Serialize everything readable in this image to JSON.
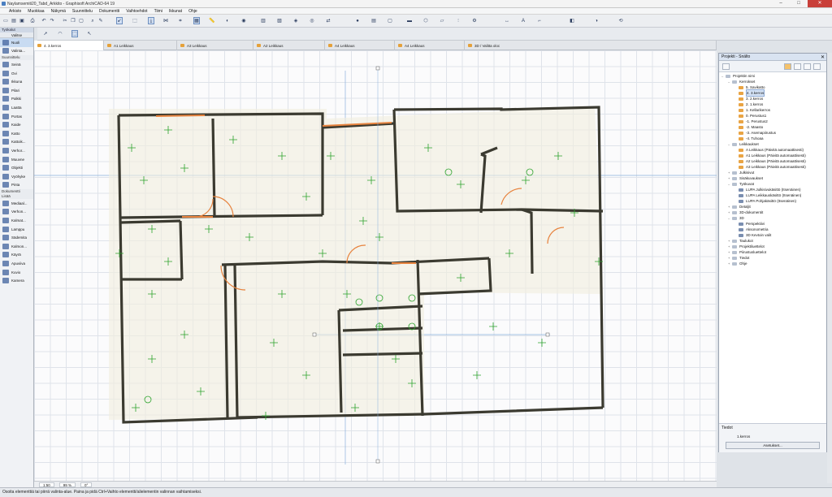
{
  "window": {
    "title": "Naylamsemiti20_Tabd_Arkkito - Graphisoft ArchiCAD-64 19",
    "min": "–",
    "max": "□",
    "close": "✕"
  },
  "menu": [
    "Arkisto",
    "Muokkaa",
    "Näkymä",
    "Suunnittelu",
    "Dokumentti",
    "Vaihtoehdot",
    "Tiimi",
    "Ikkunat",
    "Ohje"
  ],
  "tabs": [
    {
      "label": "4. 3.kerros"
    },
    {
      "label": "A1 Leikkaus"
    },
    {
      "label": "A3 Leikkaus"
    },
    {
      "label": "A2 Leikkaus"
    },
    {
      "label": "A4 Leikkaus"
    },
    {
      "label": "A4 Leikkaus"
    },
    {
      "label": "3D / Valitta oloc"
    }
  ],
  "toolbox": {
    "title": "Työkalut",
    "select": "Valitse",
    "items_top": [
      "Nuoli",
      "Valinta..."
    ],
    "group1": "Suunnittelu",
    "items1": [
      "Seinä",
      "Ovi",
      "Ikkuna",
      "Pilari",
      "Palkki",
      "Laatta",
      "Portas",
      "Kaide",
      "Katto",
      "Kattoik...",
      "Verhor...",
      "Muuvne",
      "Objekti",
      "Vyöhyke",
      "Pinta"
    ],
    "group2": "Dokumentti",
    "group3": "Lisää",
    "items2": [
      "Mediaal...",
      "Verhon...",
      "Kalmat...",
      "Lamppu",
      "Sädemita",
      "Kalmon...",
      "Käyrä",
      "Apuviiva",
      "Kuvio",
      "Kamera"
    ]
  },
  "navigator": {
    "title": "Projekti - Snälto",
    "close": "✕",
    "tree": [
      {
        "l": 0,
        "t": "Projektin nimi",
        "k": "grp",
        "e": "–"
      },
      {
        "l": 1,
        "t": "Kerrokset",
        "k": "grp",
        "e": "–"
      },
      {
        "l": 2,
        "t": "5. Savikatto",
        "k": "st"
      },
      {
        "l": 2,
        "t": "4. 3.kerros",
        "k": "st",
        "sel": true
      },
      {
        "l": 2,
        "t": "3. 2.kerros",
        "k": "st"
      },
      {
        "l": 2,
        "t": "2. 1.kerros",
        "k": "st"
      },
      {
        "l": 2,
        "t": "1. Kellarikerros",
        "k": "st"
      },
      {
        "l": 2,
        "t": "0. Perustus1",
        "k": "st"
      },
      {
        "l": 2,
        "t": "-1. Perustus2",
        "k": "st"
      },
      {
        "l": 2,
        "t": "-2. Maasto",
        "k": "st"
      },
      {
        "l": 2,
        "t": "-3. Asemapiirustus",
        "k": "st"
      },
      {
        "l": 2,
        "t": "-4. Tuhoaa",
        "k": "st"
      },
      {
        "l": 1,
        "t": "Leikkaukset",
        "k": "grp",
        "e": "–"
      },
      {
        "l": 2,
        "t": "A Leikkaus (Päivitä automaattisesti)",
        "k": "st"
      },
      {
        "l": 2,
        "t": "A1 Leikkaus (Päivitä automaattisesti)",
        "k": "st"
      },
      {
        "l": 2,
        "t": "A2 Leikkaus (Päivitä automaattisesti)",
        "k": "st"
      },
      {
        "l": 2,
        "t": "A3 Leikkaus (Päivitä automaattisesti)",
        "k": "st"
      },
      {
        "l": 1,
        "t": "Julkisivut",
        "k": "grp",
        "e": "+"
      },
      {
        "l": 1,
        "t": "Sisäkuvaukset",
        "k": "grp",
        "e": "+"
      },
      {
        "l": 1,
        "t": "Työkuvat",
        "k": "grp",
        "e": "–"
      },
      {
        "l": 2,
        "t": "LUPA Julkisivukäsittö (Itsenäinen)",
        "k": "lay"
      },
      {
        "l": 2,
        "t": "LUPA Leikkauskäsittö (Itsenäinen)",
        "k": "lay"
      },
      {
        "l": 2,
        "t": "LUPA Pohjakäsittö (Itsenäinen)",
        "k": "lay"
      },
      {
        "l": 1,
        "t": "Detaljit",
        "k": "grp",
        "e": "+"
      },
      {
        "l": 1,
        "t": "3D-dokumentit",
        "k": "grp",
        "e": "+"
      },
      {
        "l": 1,
        "t": "3D",
        "k": "grp",
        "e": "–"
      },
      {
        "l": 2,
        "t": "Perspektiivi",
        "k": "lay"
      },
      {
        "l": 2,
        "t": "Aksonometria",
        "k": "lay"
      },
      {
        "l": 2,
        "t": "3D Kevtoin valit",
        "k": "lay"
      },
      {
        "l": 1,
        "t": "Taulukot",
        "k": "grp",
        "e": "+"
      },
      {
        "l": 1,
        "t": "Projektiluettelot",
        "k": "grp",
        "e": "+"
      },
      {
        "l": 1,
        "t": "Piirustusluettelot",
        "k": "grp",
        "e": "+"
      },
      {
        "l": 1,
        "t": "Tiedot",
        "k": "grp",
        "e": "+"
      },
      {
        "l": 1,
        "t": "Ohje",
        "k": "grp",
        "e": "+"
      }
    ],
    "footer": {
      "section": "Tiedot",
      "field_value": "1.kerros",
      "button": "Asetukset..."
    }
  },
  "canvas_status": {
    "scale": "1:50",
    "zoom": "99 %",
    "angle": "0°"
  },
  "status_text": "Osoita elementtiä tai piirrä valinta-alue. Paina ja pidä Ctrl+Vaihto elementti/alielementin valinnan vaihtamiseksi."
}
